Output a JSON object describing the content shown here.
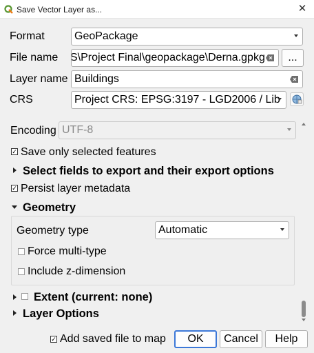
{
  "window": {
    "title": "Save Vector Layer as...",
    "app_icon": "qgis-logo-icon",
    "close_icon": "close-icon"
  },
  "form": {
    "format_label": "Format",
    "format_value": "GeoPackage",
    "filename_label": "File name",
    "filename_value": "S\\Project Final\\geopackage\\Derna.gpkg",
    "browse_label": "...",
    "layername_label": "Layer name",
    "layername_value": "Buildings",
    "crs_label": "CRS",
    "crs_value": "Project CRS: EPSG:3197 - LGD2006 / Lib"
  },
  "options": {
    "encoding_label": "Encoding",
    "encoding_value": "UTF-8",
    "save_selected_label": "Save only selected features",
    "save_selected_checked": true,
    "select_fields_label": "Select fields to export and their export options",
    "persist_metadata_label": "Persist layer metadata",
    "persist_metadata_checked": true,
    "geometry_section_label": "Geometry",
    "geometry_type_label": "Geometry type",
    "geometry_type_value": "Automatic",
    "force_multi_label": "Force multi-type",
    "force_multi_checked": false,
    "include_z_label": "Include z-dimension",
    "include_z_checked": false,
    "extent_label": "Extent (current: none)",
    "extent_checked": false,
    "layer_options_label": "Layer Options"
  },
  "footer": {
    "add_saved_label": "Add saved file to map",
    "add_saved_checked": true,
    "ok_label": "OK",
    "cancel_label": "Cancel",
    "help_label": "Help"
  }
}
